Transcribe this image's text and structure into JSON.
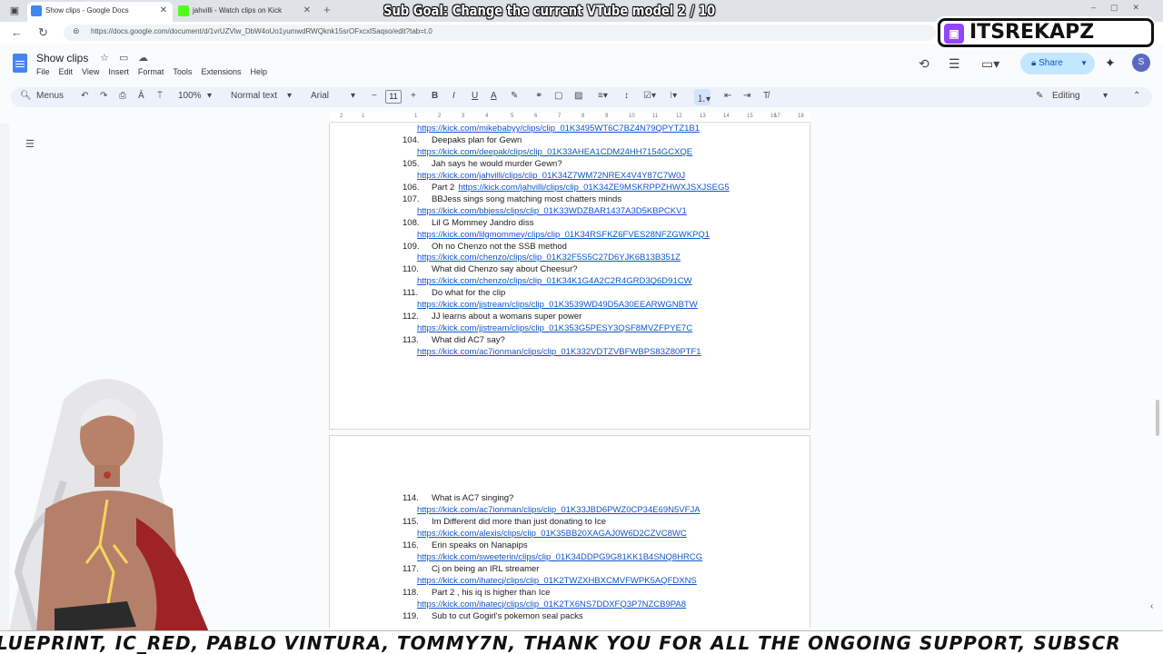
{
  "browser": {
    "tabs": [
      {
        "title": "Show clips - Google Docs",
        "active": true
      },
      {
        "title": "jahvilli - Watch clips on Kick",
        "active": false
      }
    ],
    "url": "https://docs.google.com/document/d/1vrUZVlw_DbW4oUo1yumwdRWQknk15srOFxcxlSaqso/edit?tab=t.0"
  },
  "overlay": {
    "sub_goal": "Sub Goal: Change the current VTube model  2 / 10",
    "channel": "ITSREKAPZ",
    "ticker": "LUEPRINT, IC_RED, PABLO VINTURA, TOMMY7N, THANK YOU FOR ALL THE ONGOING SUPPORT, SUBSCR"
  },
  "docs": {
    "title": "Show clips",
    "menu": [
      "File",
      "Edit",
      "View",
      "Insert",
      "Format",
      "Tools",
      "Extensions",
      "Help"
    ],
    "share_label": "Share",
    "avatar_letter": "S",
    "toolbar": {
      "menus": "Menus",
      "zoom": "100%",
      "style": "Normal text",
      "font": "Arial",
      "font_size": "11",
      "mode": "Editing"
    },
    "ruler_ticks": [
      "2",
      "1",
      "1",
      "2",
      "3",
      "4",
      "5",
      "6",
      "7",
      "8",
      "9",
      "10",
      "11",
      "12",
      "13",
      "14",
      "15",
      "16",
      "17",
      "18"
    ]
  },
  "page1_items": [
    {
      "link": "https://kick.com/mikebabyy/clips/clip_01K3495WT6C7BZ4N79QPYTZ1B1"
    },
    {
      "num": "104.",
      "text": "Deepaks plan for Gewn",
      "link": "https://kick.com/deepak/clips/clip_01K33AHEA1CDM24HH7154GCXQE"
    },
    {
      "num": "105.",
      "text": "Jah says he would murder Gewn?",
      "link": "https://kick.com/jahvilli/clips/clip_01K34Z7WM72NREX4V4Y87C7W0J"
    },
    {
      "num": "106.",
      "text": "Part 2",
      "inline_link": "https://kick.com/jahvilli/clips/clip_01K34ZE9MSKRPPZHWXJSXJSEG5"
    },
    {
      "num": "107.",
      "text": "BBJess sings song matching most chatters minds",
      "link": "https://kick.com/bbjess/clips/clip_01K33WDZBAR1437A3D5KBPCKV1"
    },
    {
      "num": "108.",
      "text": "Lil G Mommey Jandro diss",
      "link": "https://kick.com/lilgmommey/clips/clip_01K34RSFKZ6FVES28NFZGWKPQ1"
    },
    {
      "num": "109.",
      "text": "Oh no Chenzo not the SSB method",
      "link": "https://kick.com/chenzo/clips/clip_01K32F5S5C27D6YJK6B13B351Z"
    },
    {
      "num": "110.",
      "text": "What did Chenzo say about Cheesur?",
      "link": "https://kick.com/chenzo/clips/clip_01K34K1G4A2C2R4GRD3Q6D91CW"
    },
    {
      "num": "111.",
      "text": "Do what for the clip",
      "link": "https://kick.com/jjstream/clips/clip_01K3539WD49D5A30EEARWGNBTW"
    },
    {
      "num": "112.",
      "text": "JJ learns about a womans super power",
      "link": "https://kick.com/jjstream/clips/clip_01K353G5PESY3QSF8MVZFPYE7C"
    },
    {
      "num": "113.",
      "text": "What did AC7 say?",
      "link": "https://kick.com/ac7ionman/clips/clip_01K332VDTZVBFWBPS83Z80PTF1"
    }
  ],
  "page2_items": [
    {
      "num": "114.",
      "text": "What is AC7 singing?",
      "link": "https://kick.com/ac7ionman/clips/clip_01K33JBD6PWZ0CP34E69N5VFJA"
    },
    {
      "num": "115.",
      "text": "Im Different did more than just donating to Ice",
      "link": "https://kick.com/alexis/clips/clip_01K35BB20XAGAJ0W6D2CZVC8WC"
    },
    {
      "num": "116.",
      "text": "Erin speaks on Nanapips",
      "link": "https://kick.com/sweeterin/clips/clip_01K34DDPG9G81KK1B4SNQ8HRCG"
    },
    {
      "num": "117.",
      "text": "Cj on being an IRL streamer",
      "link": "https://kick.com/ihatecj/clips/clip_01K2TWZXHBXCMVFWPK5AQFDXNS"
    },
    {
      "num": "118.",
      "text": "Part 2 , his iq is higher than Ice",
      "link": "https://kick.com/ihatecj/clips/clip_01K2TX6NS7DDXFQ3P7NZCB9PA8"
    },
    {
      "num": "119.",
      "text": "Sub to cut Gogirl's pokemon seal packs"
    }
  ]
}
